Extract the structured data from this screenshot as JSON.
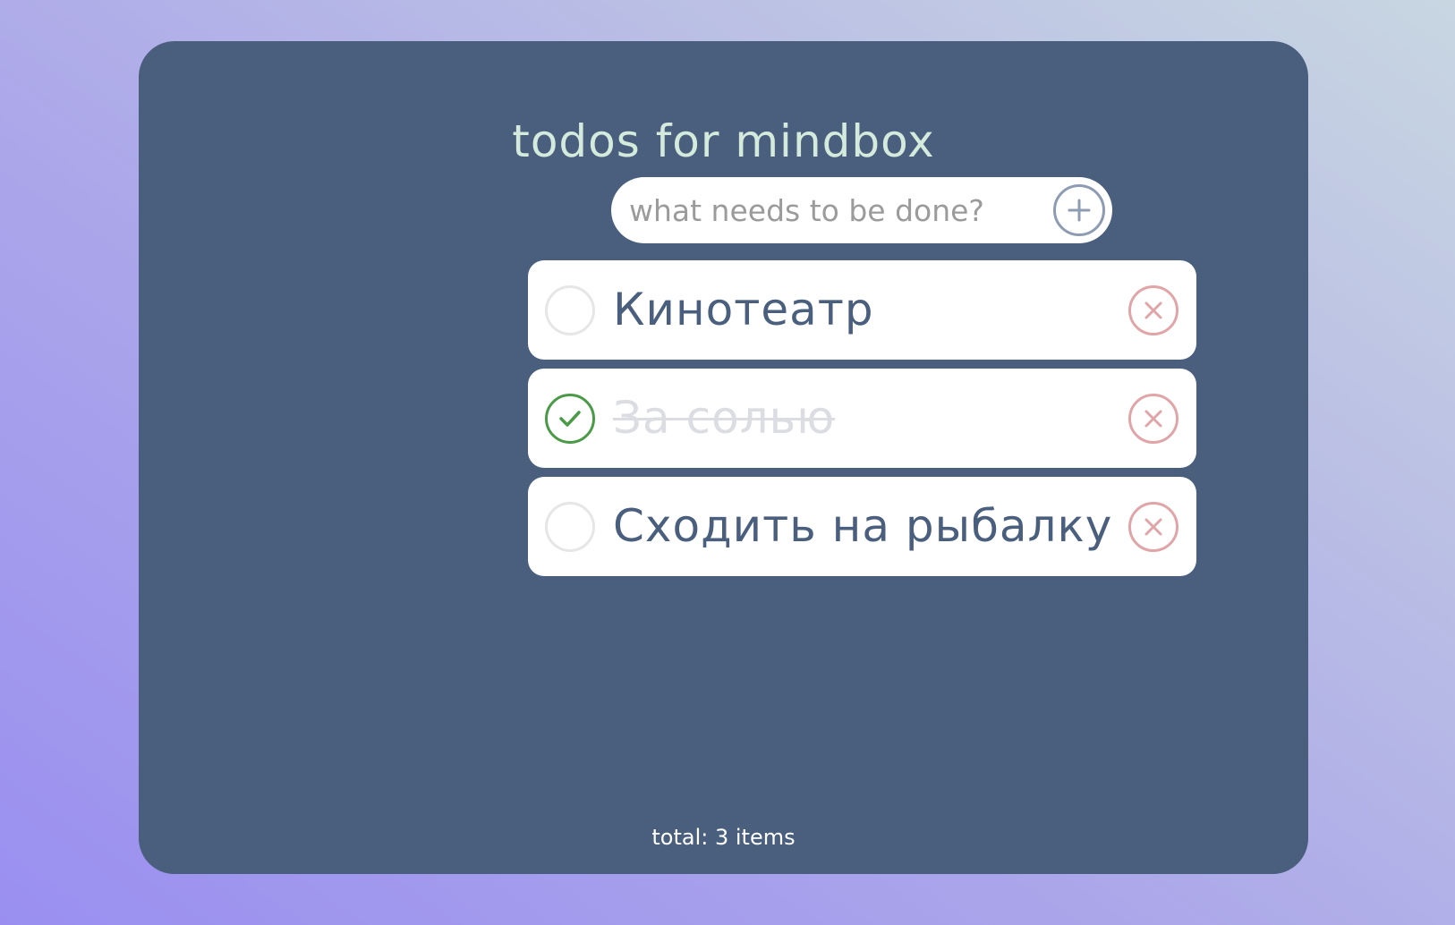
{
  "app": {
    "title": "todos for mindbox"
  },
  "add_form": {
    "placeholder": "what needs to be done?",
    "add_icon": "plus-icon"
  },
  "todos": [
    {
      "text": "Кинотеатр",
      "completed": false
    },
    {
      "text": "За солью",
      "completed": true
    },
    {
      "text": "Сходить на рыбалку",
      "completed": false
    }
  ],
  "footer": {
    "total_label": "total: 3 items"
  },
  "colors": {
    "panel": "#4a5f7d",
    "title": "#d3eadc",
    "completed_check": "#4a9a48",
    "delete": "#e0a5a8"
  }
}
